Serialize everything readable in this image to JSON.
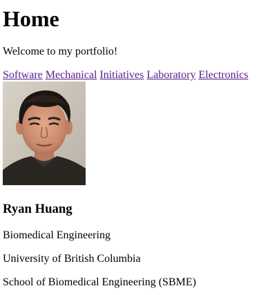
{
  "header": {
    "title": "Home",
    "welcome": "Welcome to my portfolio!"
  },
  "nav": {
    "links": [
      "Software",
      "Mechanical",
      "Initiatives",
      "Laboratory",
      "Electronics"
    ]
  },
  "profile": {
    "name": "Ryan Huang",
    "program": "Biomedical Engineering",
    "university": "University of British Columbia",
    "school": "School of Biomedical Engineering (SBME)"
  },
  "colors": {
    "link_visited": "#551a8b",
    "text": "#000000",
    "background": "#ffffff"
  }
}
